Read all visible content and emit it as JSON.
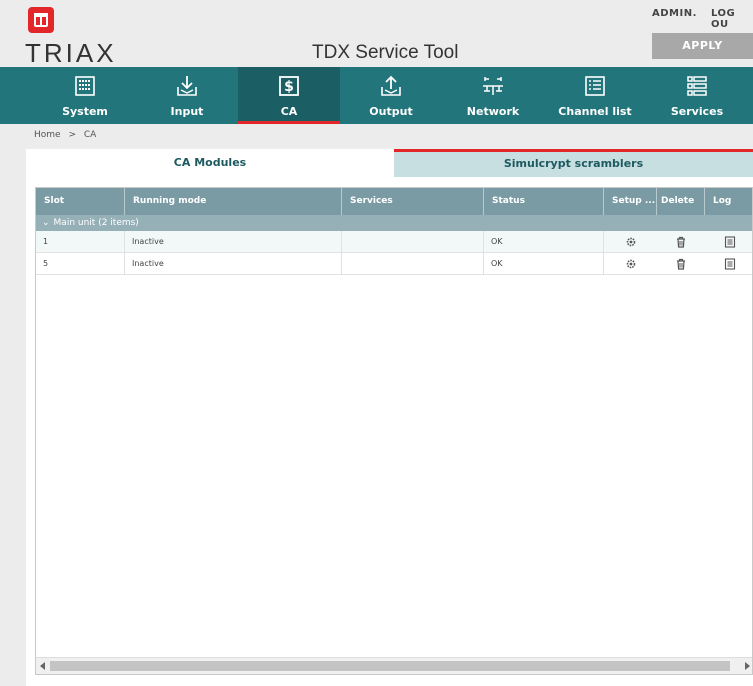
{
  "app": {
    "brand": "TRIAX",
    "title": "TDX Service Tool",
    "user": "ADMIN.",
    "logout": "LOG OU",
    "apply": "APPLY"
  },
  "nav": [
    {
      "label": "System",
      "icon": "system-icon"
    },
    {
      "label": "Input",
      "icon": "input-icon"
    },
    {
      "label": "CA",
      "icon": "ca-dollar-icon",
      "active": true
    },
    {
      "label": "Output",
      "icon": "output-icon"
    },
    {
      "label": "Network",
      "icon": "network-icon"
    },
    {
      "label": "Channel list",
      "icon": "channel-list-icon"
    },
    {
      "label": "Services",
      "icon": "services-icon"
    }
  ],
  "breadcrumb": {
    "home": "Home",
    "separator": ">",
    "current": "CA"
  },
  "tabs": {
    "ca_modules": "CA Modules",
    "simulcrypt": "Simulcrypt scramblers"
  },
  "table": {
    "columns": [
      "Slot",
      "Running mode",
      "Services",
      "Status",
      "Setup ...",
      "Delete",
      "Log"
    ],
    "group_label": "Main unit (2 items)",
    "rows": [
      {
        "slot": "1",
        "mode": "Inactive",
        "services": "",
        "status": "OK"
      },
      {
        "slot": "5",
        "mode": "Inactive",
        "services": "",
        "status": "OK"
      }
    ]
  },
  "colors": {
    "accent": "#e3262a",
    "nav": "#22757b",
    "table_header": "#7a9ba3"
  }
}
